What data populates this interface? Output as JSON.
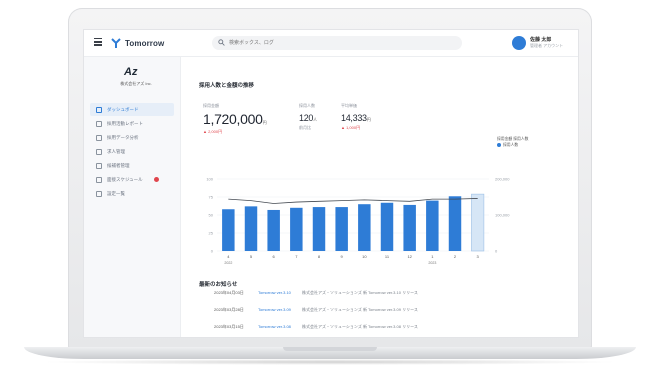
{
  "app": {
    "name": "Tomorrow",
    "search_placeholder": "検索ボックス、ログ",
    "user": {
      "name": "佐藤 太郎",
      "sub": "管理者 アカウント"
    }
  },
  "sidebar": {
    "org_logo": "Az",
    "org_name": "株式会社アズ Inc.",
    "items": [
      {
        "label": "ダッシュボード",
        "active": true
      },
      {
        "label": "採用活動レポート",
        "active": false
      },
      {
        "label": "採用データ分析",
        "active": false
      },
      {
        "label": "求人管理",
        "active": false
      },
      {
        "label": "候補者管理",
        "active": false
      },
      {
        "label": "面接スケジュール",
        "active": false,
        "badge": true
      },
      {
        "label": "設定一覧",
        "active": false
      }
    ]
  },
  "summary": {
    "title": "採用人数と金額の推移",
    "stats": [
      {
        "label": "採用金額",
        "value": "1,720,000",
        "unit": "円",
        "delta": "▲ 2,000円"
      },
      {
        "label": "採用人数",
        "value": "120",
        "unit": "人",
        "delta": "前月比"
      },
      {
        "label": "平均単価",
        "value": "14,333",
        "unit": "円",
        "delta": "▲ 1,000円"
      }
    ],
    "legend": {
      "line": "採用金額 採用人数",
      "bar": "採用人数"
    }
  },
  "chart_data": {
    "type": "bar",
    "categories": [
      "4",
      "5",
      "6",
      "7",
      "8",
      "9",
      "10",
      "11",
      "12",
      "1",
      "2",
      "3"
    ],
    "category_sub": [
      "2022",
      "",
      "",
      "",
      "",
      "",
      "",
      "",
      "",
      "2023",
      "",
      ""
    ],
    "series": [
      {
        "name": "採用人数",
        "values": [
          58,
          62,
          57,
          60,
          61,
          61,
          65,
          67,
          64,
          70,
          76,
          79
        ]
      },
      {
        "name": "採用金額",
        "values": [
          72,
          70,
          66,
          68,
          69,
          70,
          71,
          70,
          69,
          72,
          72,
          73
        ]
      }
    ],
    "last_bar_projected": true,
    "left_ticks": [
      "100",
      "75",
      "50",
      "25",
      "0"
    ],
    "right_ticks": [
      "200,000",
      "100,000",
      "0"
    ],
    "ylim": [
      0,
      100
    ]
  },
  "recent": {
    "title": "最新のお知らせ",
    "rows": [
      {
        "date": "2023年04月03日",
        "link": "Tomorrow ver.3.10",
        "desc": "株式会社アズ・ソリューションズ 新 Tomorrow ver.3.10 リリース"
      },
      {
        "date": "2023年03月28日",
        "link": "Tomorrow ver.3.09",
        "desc": "株式会社アズ・ソリューションズ 新 Tomorrow ver.3.09 リリース"
      },
      {
        "date": "2023年03月15日",
        "link": "Tomorrow ver.3.08",
        "desc": "株式会社アズ・ソリューションズ 新 Tomorrow ver.3.08 リリース"
      }
    ]
  },
  "colors": {
    "accent": "#2e7cd6",
    "bar": "#2e7cd6",
    "bar_projected": "#d6e6f6",
    "line": "#444a52",
    "alert": "#e0454c"
  }
}
